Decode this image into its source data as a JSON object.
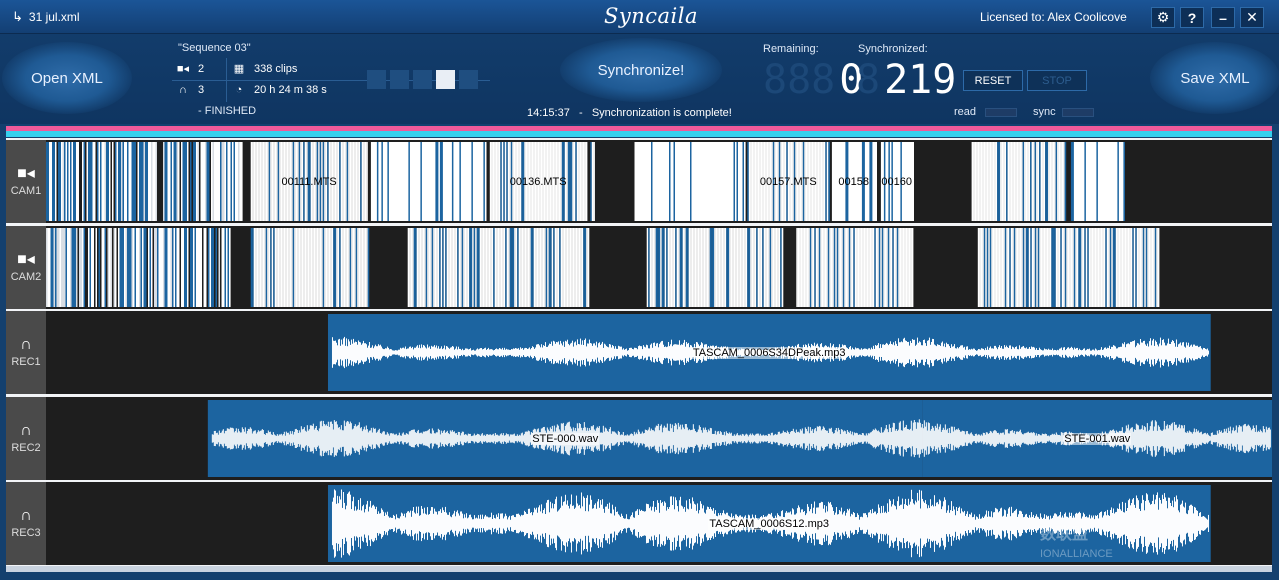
{
  "window": {
    "file_name": "31 jul.xml",
    "logo_text": "Syncaila",
    "license_text": "Licensed to: Alex Coolicove",
    "buttons": {
      "settings": "⚙",
      "help": "?",
      "minimize": "–",
      "close": "✕"
    }
  },
  "panel": {
    "open_xml": "Open XML",
    "save_xml": "Save XML",
    "synchronize": "Synchronize!",
    "sequence_name": "\"Sequence 03\"",
    "camera_count": "2",
    "clip_count": "338 clips",
    "audio_count": "3",
    "duration": "20 h 24 m 38 s",
    "finished_text": "- FINISHED",
    "status_time": "14:15:37",
    "status_sep": "-",
    "status_message": "Synchronization is complete!",
    "remaining_label": "Remaining:",
    "synchronized_label": "Synchronized:",
    "remaining_value": "0",
    "remaining_ghost": "888",
    "synchronized_value": "219",
    "synchronized_ghost": "8",
    "reset_label": "RESET",
    "stop_label": "STOP",
    "read_label": "read",
    "sync_label": "sync",
    "progress_squares": [
      false,
      false,
      false,
      true,
      false
    ]
  },
  "colors": {
    "accent": "#1e6aa6",
    "progress_pink": "#f05a9a",
    "progress_cyan": "#35d0ee",
    "clip_blue": "#1c64a0",
    "track_bg": "#1e1e1e"
  },
  "tracks": [
    {
      "label": "CAM1",
      "icon": "camera-icon",
      "type": "video",
      "clips": [
        {
          "name": "00111.MTS",
          "start": 0.167,
          "end": 0.262
        },
        {
          "name": "00136.MTS",
          "start": 0.362,
          "end": 0.441
        },
        {
          "name": "00157.MTS",
          "start": 0.572,
          "end": 0.639
        },
        {
          "name": "00158",
          "start": 0.641,
          "end": 0.677
        },
        {
          "name": "00160",
          "start": 0.681,
          "end": 0.707
        }
      ],
      "regions": [
        [
          0.0,
          0.16
        ],
        [
          0.167,
          0.262
        ],
        [
          0.265,
          0.358
        ],
        [
          0.362,
          0.441
        ],
        [
          0.444,
          0.447
        ],
        [
          0.48,
          0.57
        ],
        [
          0.572,
          0.639
        ],
        [
          0.641,
          0.677
        ],
        [
          0.681,
          0.707
        ],
        [
          0.755,
          0.832
        ],
        [
          0.836,
          0.88
        ]
      ]
    },
    {
      "label": "CAM2",
      "icon": "camera-icon",
      "type": "video",
      "clips": [],
      "regions": [
        [
          0.0,
          0.15
        ],
        [
          0.167,
          0.263
        ],
        [
          0.295,
          0.442
        ],
        [
          0.49,
          0.601
        ],
        [
          0.612,
          0.707
        ],
        [
          0.76,
          0.908
        ]
      ]
    },
    {
      "label": "REC1",
      "icon": "headphones-icon",
      "type": "audio",
      "clips": [
        {
          "name": "TASCAM_0006S34DPeak.mp3",
          "start": 0.23,
          "end": 0.95
        }
      ],
      "amp": 0.45
    },
    {
      "label": "REC2",
      "icon": "headphones-icon",
      "type": "audio",
      "clips": [
        {
          "name": "STE-000.wav",
          "start": 0.132,
          "end": 0.715
        },
        {
          "name": "STE-001.wav",
          "start": 0.715,
          "end": 1.0
        }
      ],
      "amp": 0.55
    },
    {
      "label": "REC3",
      "icon": "headphones-icon",
      "type": "audio",
      "clips": [
        {
          "name": "TASCAM_0006S12.mp3",
          "start": 0.23,
          "end": 0.95
        }
      ],
      "amp": 0.98
    }
  ],
  "watermark": {
    "line1": "数联盟",
    "line2": "IONALLIANCE"
  }
}
